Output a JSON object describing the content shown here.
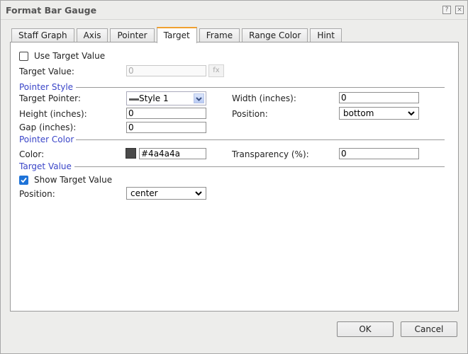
{
  "window": {
    "title": "Format Bar Gauge",
    "help_label": "?",
    "close_label": "×"
  },
  "tabs": [
    {
      "label": "Staff Graph",
      "active": false
    },
    {
      "label": "Axis",
      "active": false
    },
    {
      "label": "Pointer",
      "active": false
    },
    {
      "label": "Target",
      "active": true
    },
    {
      "label": "Frame",
      "active": false
    },
    {
      "label": "Range Color",
      "active": false
    },
    {
      "label": "Hint",
      "active": false
    }
  ],
  "target": {
    "use_target_value": {
      "label": "Use Target Value",
      "checked": false
    },
    "target_value": {
      "label": "Target Value:",
      "value": "0",
      "fx_label": "fx",
      "disabled": true
    }
  },
  "pointer_style": {
    "section_label": "Pointer Style",
    "target_pointer": {
      "label": "Target Pointer:",
      "value": "Style 1"
    },
    "width": {
      "label": "Width (inches):",
      "value": "0"
    },
    "height": {
      "label": "Height (inches):",
      "value": "0"
    },
    "position": {
      "label": "Position:",
      "value": "bottom"
    },
    "gap": {
      "label": "Gap (inches):",
      "value": "0"
    }
  },
  "pointer_color": {
    "section_label": "Pointer Color",
    "color": {
      "label": "Color:",
      "value": "#4a4a4a",
      "swatch": "#4a4a4a"
    },
    "transparency": {
      "label": "Transparency (%):",
      "value": "0"
    }
  },
  "target_value_section": {
    "section_label": "Target Value",
    "show_target_value": {
      "label": "Show Target Value",
      "checked": true
    },
    "position": {
      "label": "Position:",
      "value": "center"
    }
  },
  "footer": {
    "ok_label": "OK",
    "cancel_label": "Cancel"
  },
  "colors": {
    "accent_tab": "#f0a030",
    "section_header": "#3a45c8",
    "checkbox_checked": "#1e73d8"
  }
}
